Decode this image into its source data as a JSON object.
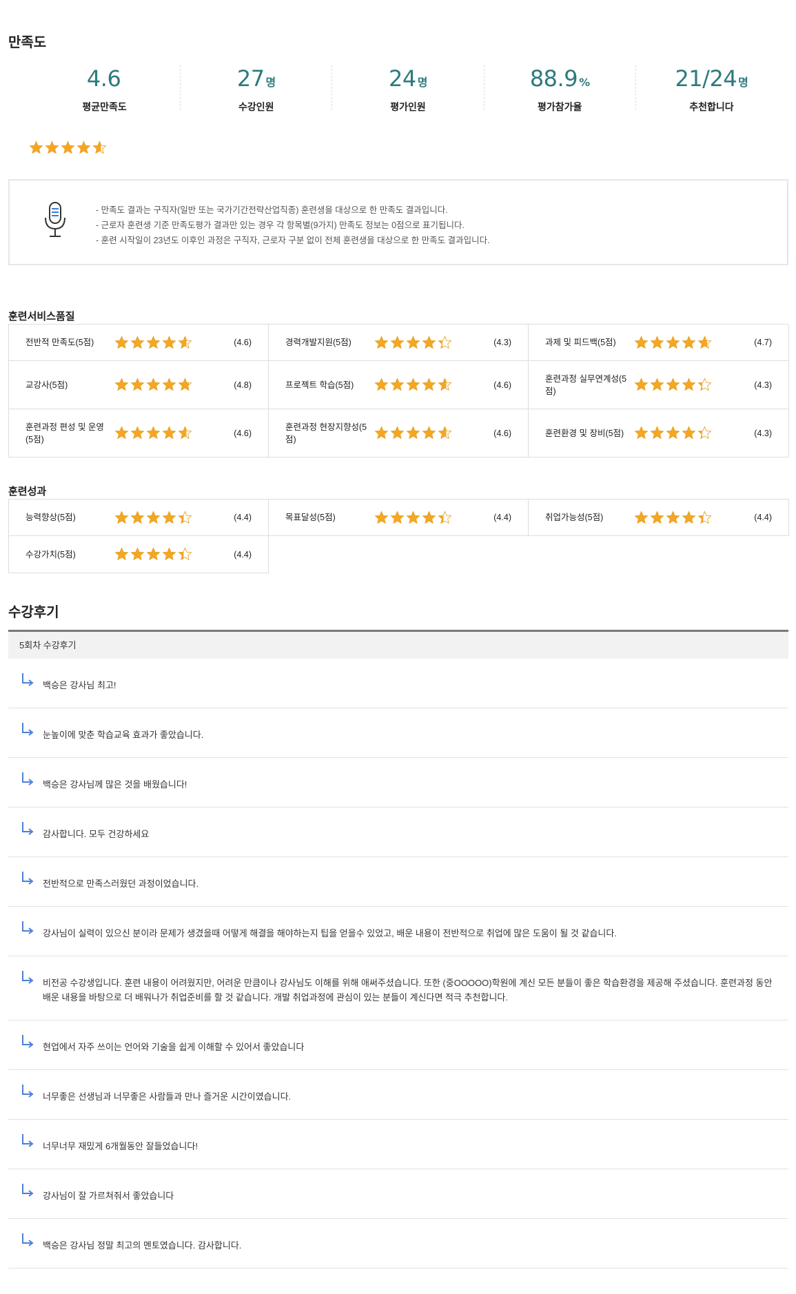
{
  "satisfaction": {
    "title": "만족도",
    "stats": [
      {
        "value": "4.6",
        "unit": "",
        "label": "평균만족도"
      },
      {
        "value": "27",
        "unit": "명",
        "label": "수강인원"
      },
      {
        "value": "24",
        "unit": "명",
        "label": "평가인원"
      },
      {
        "value": "88.9",
        "unit": "%",
        "label": "평가참가율"
      },
      {
        "value": "21/24",
        "unit": "명",
        "label": "추천합니다"
      }
    ],
    "average_rating": 4.6,
    "notice": [
      "- 만족도 결과는 구직자(일반 또는 국가기간전략산업직종) 훈련생을 대상으로 한 만족도 결과입니다.",
      "- 근로자 훈련생 기준 만족도평가 결과만 있는 경우 각 항목별(9가지) 만족도 정보는 0점으로 표기됩니다.",
      "- 훈련 시작일이 23년도 이후인 과정은 구직자, 근로자 구분 없이 전체 훈련생을 대상으로 한 만족도 결과입니다."
    ]
  },
  "service_quality": {
    "title": "훈련서비스품질",
    "items": [
      {
        "name": "전반적 만족도(5점)",
        "rating": 4.6,
        "score": "(4.6)"
      },
      {
        "name": "경력개발지원(5점)",
        "rating": 4.3,
        "score": "(4.3)"
      },
      {
        "name": "과제 및 피드백(5점)",
        "rating": 4.7,
        "score": "(4.7)"
      },
      {
        "name": "교강사(5점)",
        "rating": 4.8,
        "score": "(4.8)"
      },
      {
        "name": "프로젝트 학습(5점)",
        "rating": 4.6,
        "score": "(4.6)"
      },
      {
        "name": "훈련과정 실무연계성(5점)",
        "rating": 4.3,
        "score": "(4.3)"
      },
      {
        "name": "훈련과정 편성 및 운영(5점)",
        "rating": 4.6,
        "score": "(4.6)"
      },
      {
        "name": "훈련과정 현장지향성(5점)",
        "rating": 4.6,
        "score": "(4.6)"
      },
      {
        "name": "훈련환경 및 장비(5점)",
        "rating": 4.3,
        "score": "(4.3)"
      }
    ]
  },
  "outcomes": {
    "title": "훈련성과",
    "items": [
      {
        "name": "능력향상(5점)",
        "rating": 4.4,
        "score": "(4.4)"
      },
      {
        "name": "목표달성(5점)",
        "rating": 4.4,
        "score": "(4.4)"
      },
      {
        "name": "취업가능성(5점)",
        "rating": 4.4,
        "score": "(4.4)"
      },
      {
        "name": "수강가치(5점)",
        "rating": 4.4,
        "score": "(4.4)"
      }
    ]
  },
  "reviews": {
    "title": "수강후기",
    "header": "5회차 수강후기",
    "items": [
      "백승은 강사님 최고!",
      "눈높이에 맞춘 학습교육 효과가 좋았습니다.",
      "백승은 강사님께 많은 것을 배웠습니다!",
      "감사합니다. 모두 건강하세요",
      "전반적으로 만족스러웠던 과정이었습니다.",
      "강사님이 실력이 있으신 분이라 문제가 생겼을때 어떻게 해결을 해야하는지 팁을 얻을수 있었고, 배운 내용이 전반적으로 취업에 많은 도움이 될 것 같습니다.",
      "비전공 수강생입니다. 훈련 내용이 어려웠지만, 어려운 만큼이나 강사님도 이해를 위해 애써주셨습니다. 또한 (중OOOOO)학원에 계신 모든 분들이 좋은 학습환경을 제공해 주셨습니다. 훈련과정 동안 배운 내용을 바탕으로 더 배워나가 취업준비를 할 것 같습니다. 개발 취업과정에 관심이 있는 분들이 계신다면 적극 추천합니다.",
      "현업에서 자주 쓰이는 언어와 기술을 쉽게 이해할 수 있어서 좋았습니다",
      "너무좋은 선생님과 너무좋은 사람들과 만나 즐거운 시간이였습니다.",
      "너무너무 재밌게 6개월동안 잘들었습니다!",
      "강사님이 잘 가르쳐줘서 좋았습니다",
      "백승은 강사님 정말 최고의 멘토였습니다. 감사합니다."
    ]
  },
  "colors": {
    "accent": "#2e7a7c",
    "star": "#f5a623",
    "star_empty": "#bfbfbf",
    "arrow": "#4a7fd6"
  }
}
